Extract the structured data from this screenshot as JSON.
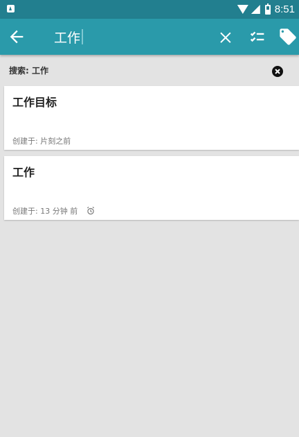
{
  "status_bar": {
    "time": "8:51",
    "icons": [
      "app-notification-icon",
      "wifi-icon",
      "signal-icon",
      "battery-icon"
    ]
  },
  "toolbar": {
    "search_value": "工作",
    "back_icon": "arrow-back-icon",
    "clear_icon": "close-icon",
    "checklist_icon": "checklist-icon",
    "tag_icon": "tag-icon"
  },
  "search_header": {
    "label": "搜索: 工作",
    "clear_icon": "close-circle-icon"
  },
  "notes": [
    {
      "title": "工作目标",
      "meta": "创建于: 片刻之前",
      "has_reminder": false
    },
    {
      "title": "工作",
      "meta": "创建于: 13 分钟 前",
      "has_reminder": true,
      "reminder_icon": "alarm-icon"
    }
  ],
  "colors": {
    "status_bar": "#227f8f",
    "toolbar": "#2a9aaa",
    "background": "#e3e3e3",
    "card": "#ffffff"
  }
}
